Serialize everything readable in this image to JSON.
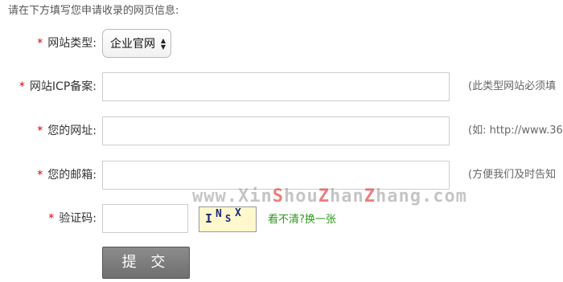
{
  "intro": "请在下方填写您申请收录的网页信息:",
  "required_mark": "*",
  "site_type": {
    "label": "网站类型:",
    "selected": "企业官网"
  },
  "icp": {
    "label": "网站ICP备案:",
    "value": "",
    "hint": "(此类型网站必须填"
  },
  "url": {
    "label": "您的网址:",
    "value": "",
    "hint": "(如: http://www.36"
  },
  "email": {
    "label": "您的邮箱:",
    "value": "",
    "hint": "(方便我们及时告知"
  },
  "captcha": {
    "label": "验证码:",
    "value": "",
    "chars": [
      "I",
      "N",
      "S",
      "X"
    ],
    "refresh_text": "看不清?换一张"
  },
  "submit_label": "提 交",
  "watermark": {
    "prefix": "www.Xin",
    "s": "S",
    "hou": "hou",
    "z1": "Z",
    "han": "han",
    "z2": "Z",
    "rest": "hang.com"
  },
  "colors": {
    "required": "#d60000",
    "link_green": "#2a9a1a",
    "button": "#7d7d7d"
  }
}
